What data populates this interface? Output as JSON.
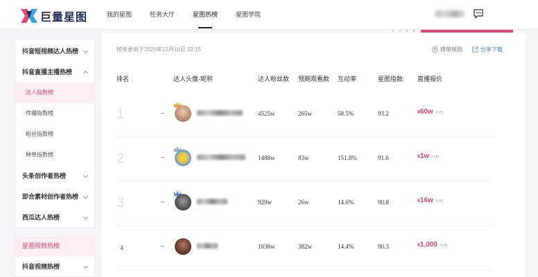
{
  "header": {
    "logo_text": "巨量星图",
    "nav": [
      "我的星图",
      "任务大厅",
      "星图热榜",
      "星图学院"
    ],
    "active_nav": "星图热榜"
  },
  "sidebar": {
    "items": [
      {
        "label": "抖音短视频达人热榜",
        "type": "group"
      },
      {
        "label": "抖音直播主播热榜",
        "type": "group-open"
      },
      {
        "label": "达人指数榜",
        "type": "sub-active"
      },
      {
        "label": "传播指数榜",
        "type": "sub"
      },
      {
        "label": "粉丝指数榜",
        "type": "sub"
      },
      {
        "label": "种草指数榜",
        "type": "sub"
      },
      {
        "label": "头条创作者热榜",
        "type": "group"
      },
      {
        "label": "即合素材创作者热榜",
        "type": "group"
      },
      {
        "label": "西瓜达人热榜",
        "type": "group"
      }
    ],
    "second_group": [
      {
        "label": "星图视频热榜",
        "type": "active"
      },
      {
        "label": "抖音视频热榜",
        "type": "group"
      }
    ]
  },
  "toolbar": {
    "updated": "榜单更新于2020年12月19日 22:15",
    "rules": "榜单规则",
    "share": "分享下载"
  },
  "table": {
    "headers": [
      "排名",
      "达人头像·昵称",
      "达人粉丝数",
      "预期观看数",
      "互动率",
      "星图指数",
      "直播报价"
    ],
    "rows": [
      {
        "rank": "1",
        "trend": "–",
        "fans": "4525w",
        "views": "265w",
        "engagement": "58.5%",
        "index": "93.2",
        "currency": "¥",
        "price": "60w",
        "unit": "/小时"
      },
      {
        "rank": "2",
        "trend": "–",
        "fans": "1488w",
        "views": "83w",
        "engagement": "151.8%",
        "index": "91.6",
        "currency": "¥",
        "price": "1w",
        "unit": "/小时"
      },
      {
        "rank": "3",
        "trend": "–",
        "fans": "929w",
        "views": "26w",
        "engagement": "14.6%",
        "index": "90.8",
        "currency": "¥",
        "price": "16w",
        "unit": "/小时"
      },
      {
        "rank": "4",
        "trend": "–",
        "fans": "1036w",
        "views": "382w",
        "engagement": "14.4%",
        "index": "90.3",
        "currency": "¥",
        "price": "1,000",
        "unit": "/小时"
      }
    ]
  },
  "colors": {
    "accent": "#d9417a",
    "link": "#3c7be0",
    "brand_navy": "#1f2f55"
  },
  "icons": {
    "logo": "logo-mark-icon",
    "message": "message-icon",
    "rules": "question-circle-icon",
    "share": "share-icon",
    "chevron": "chevron-down-icon",
    "crown": "crown-icon"
  }
}
